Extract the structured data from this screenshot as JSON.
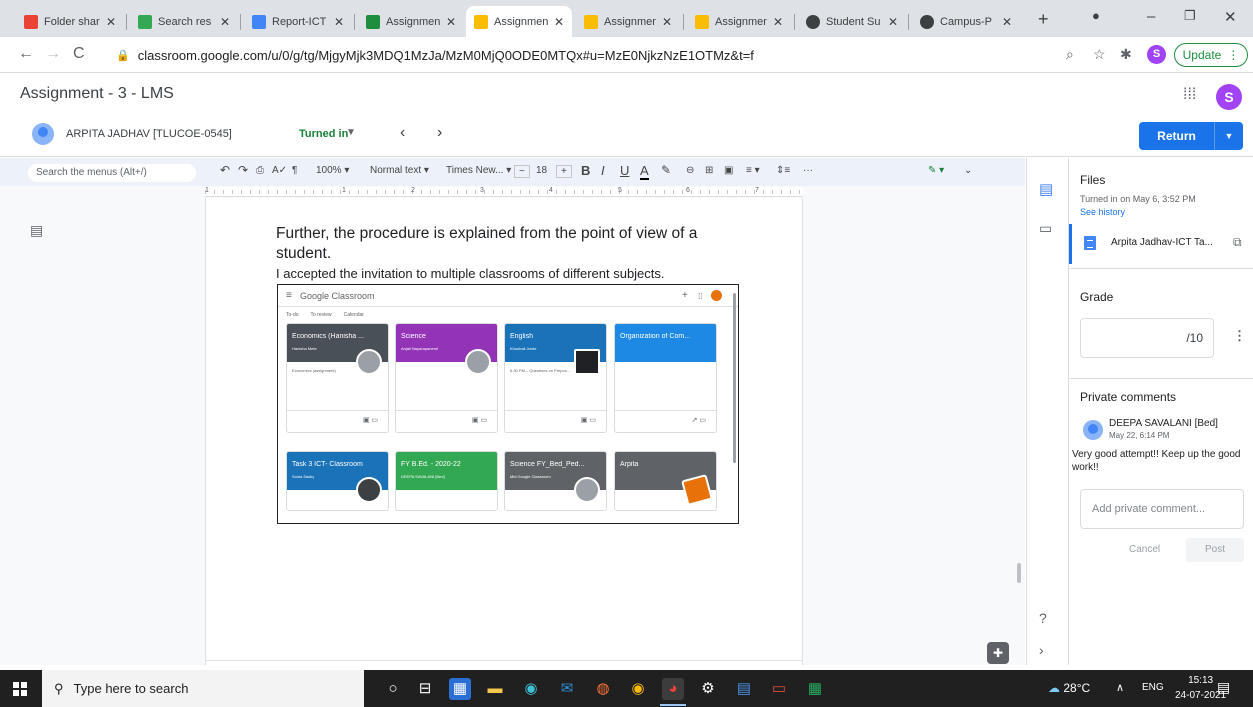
{
  "browser": {
    "tabs": [
      {
        "label": "Folder shar",
        "fav_color": "#ea4335"
      },
      {
        "label": "Search res",
        "fav_color": "#34a853"
      },
      {
        "label": "Report-ICT",
        "fav_color": "#4285f4"
      },
      {
        "label": "Assignmen",
        "fav_color": "#1e8e3e"
      },
      {
        "label": "Assignmen",
        "fav_color": "#fbbc04",
        "active": true
      },
      {
        "label": "Assignmen",
        "fav_color": "#fbbc04"
      },
      {
        "label": "Assignmen",
        "fav_color": "#fbbc04"
      },
      {
        "label": "Student Su",
        "fav_color": "#3c4043"
      },
      {
        "label": "Campus-P",
        "fav_color": "#3c4043"
      }
    ],
    "url": "classroom.google.com/u/0/g/tg/MjgyMjk3MDQ1MzJa/MzM0MjQ0ODE0MTQx#u=MzE0NjkzNzE1OTMz&t=f",
    "profile_initial": "S",
    "update_label": "Update"
  },
  "classroom": {
    "title": "Assignment - 3 - LMS",
    "account_initial": "S",
    "student_name": "ARPITA JADHAV [TLUCOE-0545]",
    "status": "Turned in",
    "return_label": "Return"
  },
  "docs": {
    "menu_search_placeholder": "Search the menus (Alt+/)",
    "zoom": "100%",
    "style": "Normal text",
    "font": "Times New...",
    "font_size": "18",
    "ruler_marks": [
      "1",
      "1",
      "2",
      "3",
      "4",
      "5",
      "6",
      "7"
    ],
    "paragraph1": "Further, the procedure is explained from the point of view of a student.",
    "paragraph2": "I accepted the invitation to multiple classrooms of different subjects.",
    "embedded": {
      "brand": "Google Classroom",
      "nav": [
        "To-do",
        "To review",
        "Calendar"
      ],
      "cards": [
        {
          "title": "Economics (Hanisha ...",
          "sub": "Hanisha Mete",
          "due": "Economics (assignment)",
          "color": "#4a5057"
        },
        {
          "title": "Science",
          "sub": "Anjali Nayarapanemi",
          "due": "",
          "color": "#9334b7"
        },
        {
          "title": "English",
          "sub": "Khushali Jorde",
          "due": "6:30 PM – Questions on Prepos...",
          "color": "#1a73b8"
        },
        {
          "title": "Organization of Com...",
          "sub": "",
          "due": "",
          "color": "#1e88e5"
        },
        {
          "title": "Task 3 ICT- Classroom",
          "sub": "Sonia Sadiq",
          "due": "",
          "color": "#1a73b8"
        },
        {
          "title": "FY B.Ed. - 2020-22",
          "sub": "DEEPA SAVALANI [Bed]",
          "due": "",
          "color": "#33a852"
        },
        {
          "title": "Science FY_Bed_Ped...",
          "sub": "Mid Google Classroom",
          "due": "",
          "color": "#5f6368"
        },
        {
          "title": "Arpita",
          "sub": "",
          "due": "",
          "color": "#5f6368"
        }
      ]
    }
  },
  "panel": {
    "files_label": "Files",
    "turned_in_on": "Turned in on May 6, 3:52 PM",
    "see_history": "See history",
    "attachment": "Arpita Jadhav-ICT Ta...",
    "grade_label": "Grade",
    "grade_value": "/10",
    "private_comments_label": "Private comments",
    "comment_author": "DEEPA SAVALANI [Bed]",
    "comment_time": "May 22, 6:14 PM",
    "comment_text": "Very good attempt!! Keep up the good work!!",
    "comment_placeholder": "Add private comment...",
    "cancel_label": "Cancel",
    "post_label": "Post"
  },
  "taskbar": {
    "search_placeholder": "Type here to search",
    "weather": "28°C",
    "language": "ENG",
    "time": "15:13",
    "date": "24-07-2021"
  }
}
